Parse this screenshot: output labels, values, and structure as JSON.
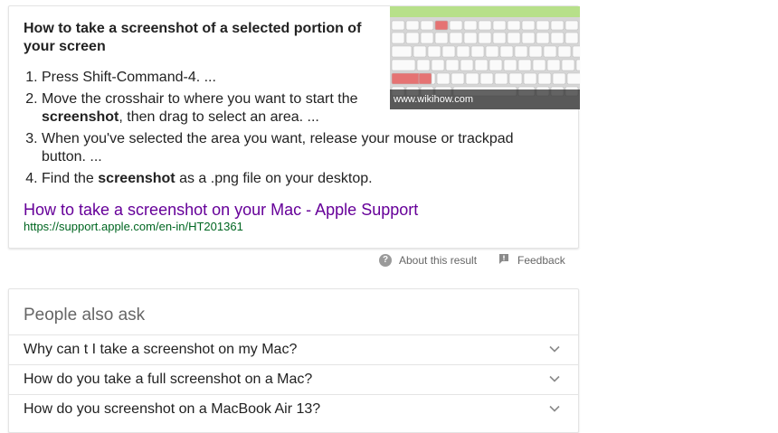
{
  "featured_snippet": {
    "title": "How to take a screenshot of a selected portion of your screen",
    "steps": [
      {
        "before": "Press Shift-Command-4. ...",
        "bold": "",
        "after": ""
      },
      {
        "before": "Move the crosshair to where you want to start the ",
        "bold": "screenshot",
        "after": ", then drag to select an area. ..."
      },
      {
        "before": "When you've selected the area you want, release your mouse or trackpad button. ...",
        "bold": "",
        "after": ""
      },
      {
        "before": "Find the ",
        "bold": "screenshot",
        "after": " as a .png file on your desktop."
      }
    ],
    "image_watermark": "www.wikihow.com",
    "source_title": "How to take a screenshot on your Mac - Apple Support",
    "source_url": "https://support.apple.com/en-in/HT201361"
  },
  "meta": {
    "about_label": "About this result",
    "feedback_label": "Feedback",
    "about_icon": "help-circle-icon",
    "feedback_icon": "feedback-flag-icon"
  },
  "people_also_ask": {
    "heading": "People also ask",
    "questions": [
      "Why can t I take a screenshot on my Mac?",
      "How do you take a full screenshot on a Mac?",
      "How do you screenshot on a MacBook Air 13?"
    ],
    "expand_icon": "chevron-down-icon"
  },
  "colors": {
    "link_visited": "#660099",
    "url_green": "#006621",
    "muted_text": "#666666",
    "border": "#e4e4e4",
    "key_highlight": "#e57373"
  }
}
